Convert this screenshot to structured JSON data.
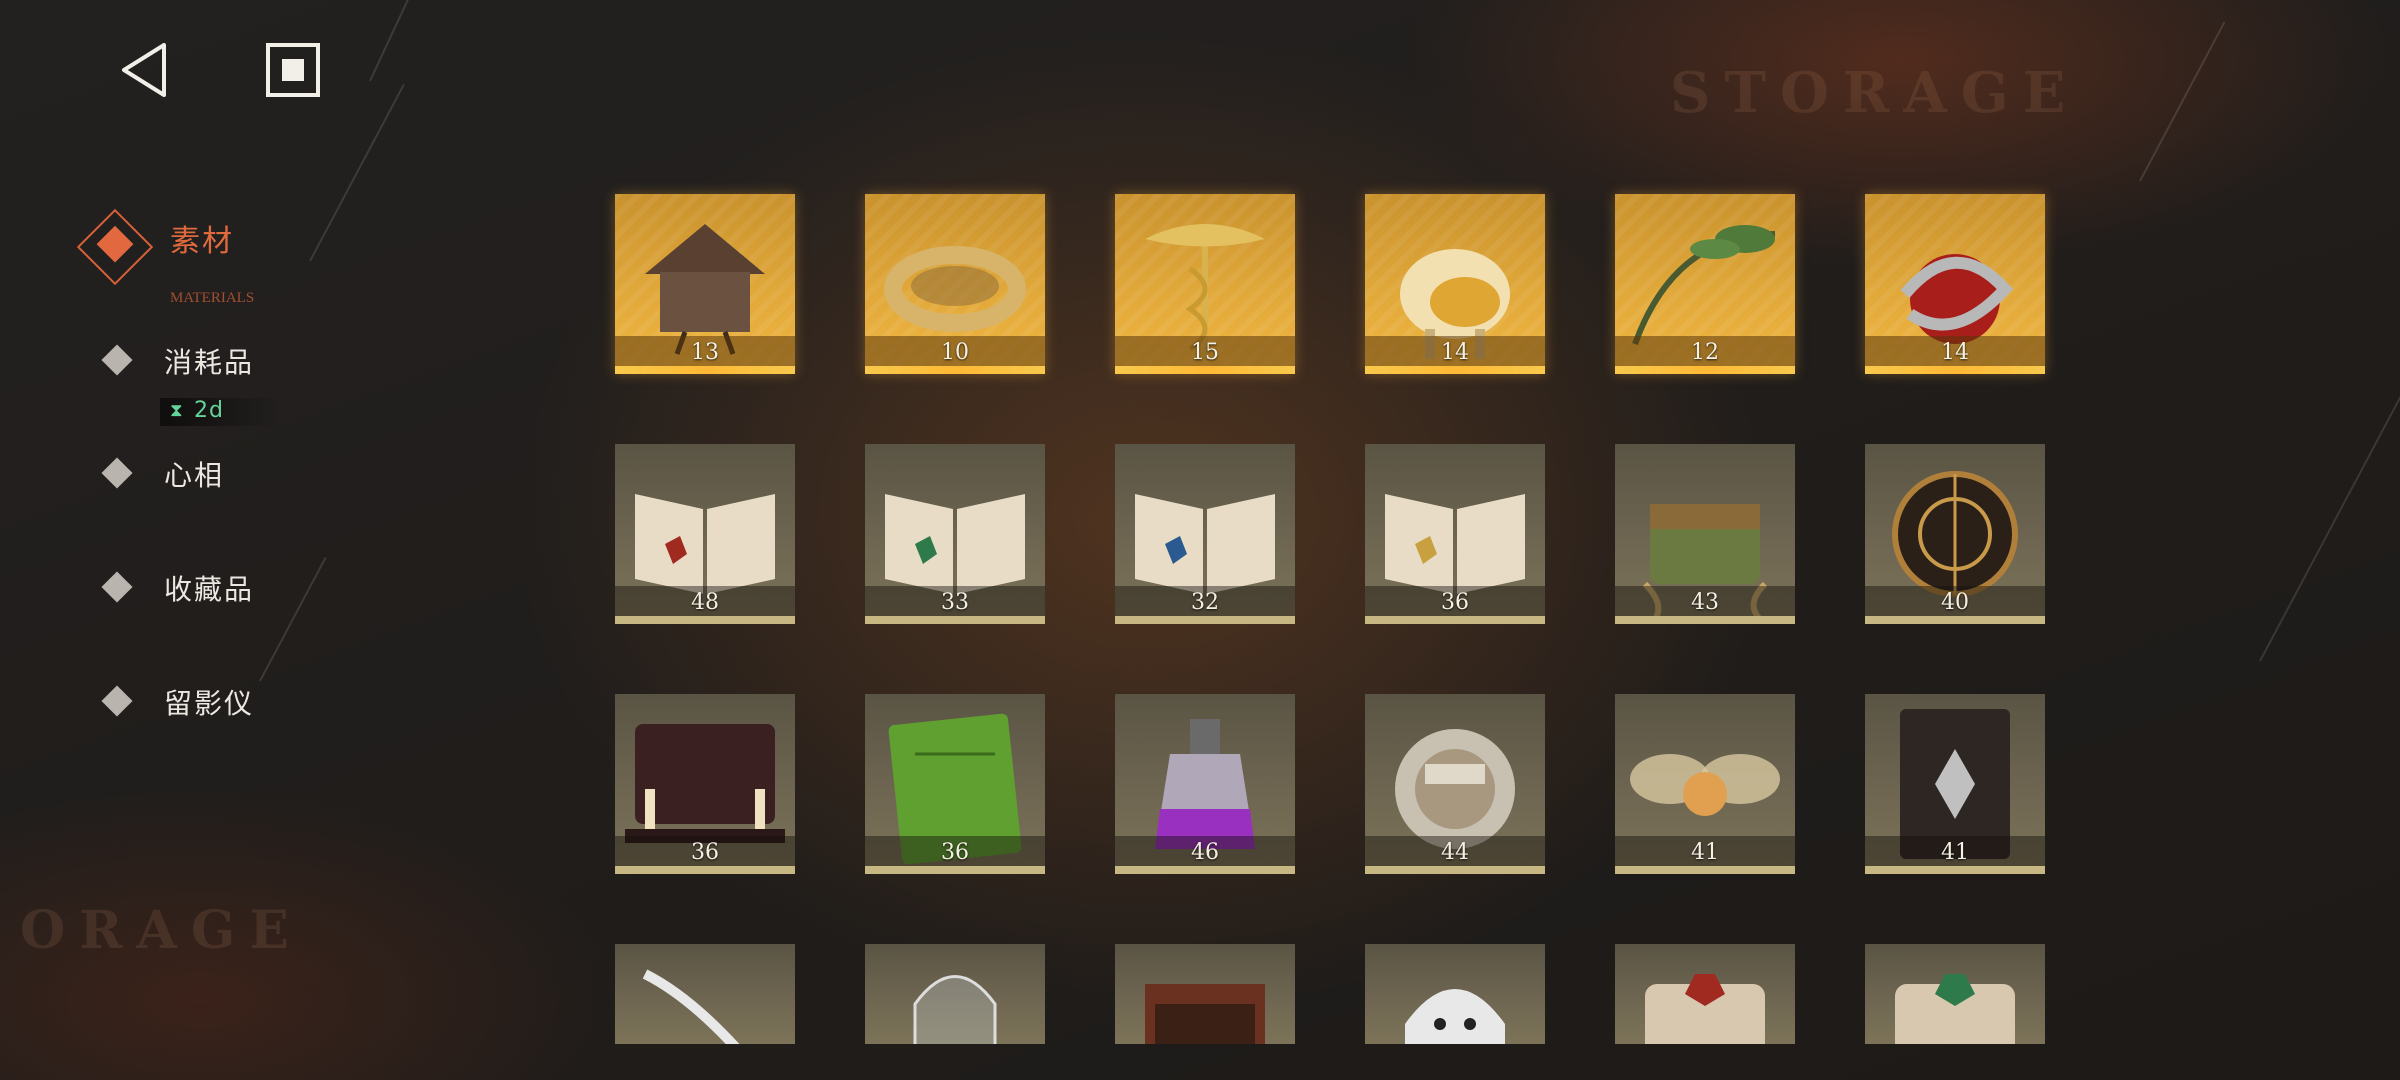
{
  "background": {
    "watermark_top": "STORAGE",
    "watermark_left": "ORAGE"
  },
  "sidebar": {
    "active": {
      "label": "素材",
      "sub": "MATERIALS"
    },
    "items": [
      {
        "label": "消耗品"
      },
      {
        "label": "心相"
      },
      {
        "label": "收藏品"
      },
      {
        "label": "留影仪"
      }
    ],
    "timer": {
      "value": "2d",
      "color": "#63d49a"
    }
  },
  "accent_color": "#e2693f",
  "items": [
    {
      "count": "13",
      "icon": "hut-icon",
      "rarity": "gold"
    },
    {
      "count": "10",
      "icon": "golden-ring-icon",
      "rarity": "gold"
    },
    {
      "count": "15",
      "icon": "caduceus-icon",
      "rarity": "gold"
    },
    {
      "count": "14",
      "icon": "golden-sheep-icon",
      "rarity": "gold"
    },
    {
      "count": "12",
      "icon": "olive-branch-icon",
      "rarity": "gold"
    },
    {
      "count": "14",
      "icon": "snake-apple-icon",
      "rarity": "gold"
    },
    {
      "count": "48",
      "icon": "book-red-gem-icon",
      "rarity": "plain"
    },
    {
      "count": "33",
      "icon": "book-green-gem-icon",
      "rarity": "plain"
    },
    {
      "count": "32",
      "icon": "book-blue-gem-icon",
      "rarity": "plain"
    },
    {
      "count": "36",
      "icon": "book-gold-gem-icon",
      "rarity": "plain"
    },
    {
      "count": "43",
      "icon": "treasure-chest-roots-icon",
      "rarity": "plain"
    },
    {
      "count": "40",
      "icon": "astrolabe-icon",
      "rarity": "plain"
    },
    {
      "count": "36",
      "icon": "ouija-board-icon",
      "rarity": "plain"
    },
    {
      "count": "36",
      "icon": "green-tome-icon",
      "rarity": "plain"
    },
    {
      "count": "46",
      "icon": "potion-bottle-icon",
      "rarity": "plain"
    },
    {
      "count": "44",
      "icon": "silver-medallion-icon",
      "rarity": "plain"
    },
    {
      "count": "41",
      "icon": "moth-bulb-icon",
      "rarity": "plain"
    },
    {
      "count": "41",
      "icon": "dark-grimoire-icon",
      "rarity": "plain"
    },
    {
      "count": "",
      "icon": "silver-feather-icon",
      "rarity": "plain"
    },
    {
      "count": "",
      "icon": "glass-bell-jar-icon",
      "rarity": "plain"
    },
    {
      "count": "",
      "icon": "open-case-icon",
      "rarity": "plain"
    },
    {
      "count": "",
      "icon": "ghost-sheet-icon",
      "rarity": "plain"
    },
    {
      "count": "",
      "icon": "scroll-red-gem-icon",
      "rarity": "plain"
    },
    {
      "count": "",
      "icon": "scroll-green-gem-icon",
      "rarity": "plain"
    }
  ]
}
